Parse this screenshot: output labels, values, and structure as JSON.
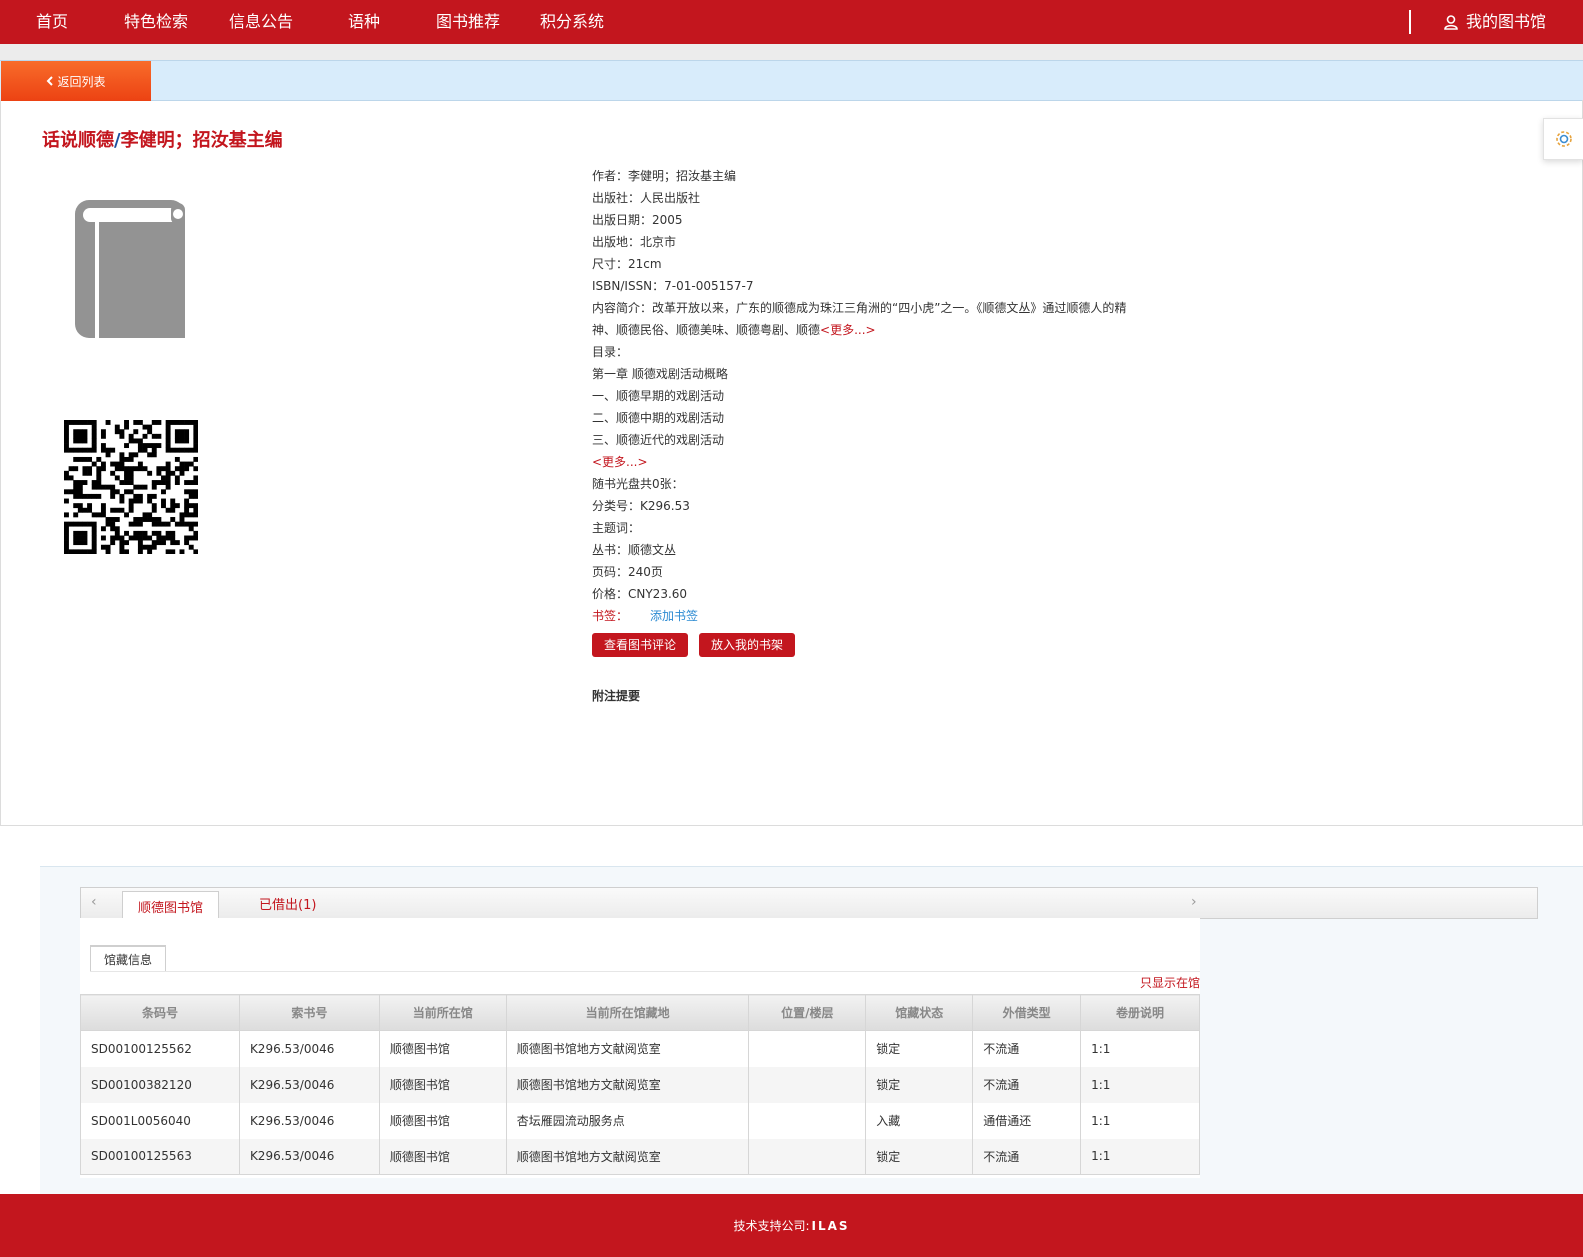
{
  "nav": {
    "items": [
      "首页",
      "特色检索",
      "信息公告",
      "语种",
      "图书推荐",
      "积分系统"
    ],
    "my_library": "我的图书馆"
  },
  "back_label": "返回列表",
  "book": {
    "title_main": "话说顺德",
    "title_slash": "/",
    "title_author": "李健明；招汝基主编"
  },
  "info": {
    "author": "作者：李健明；招汝基主编",
    "publisher": "出版社：人民出版社",
    "pub_date": "出版日期：2005",
    "pub_place": "出版地：北京市",
    "size": "尺寸：21cm",
    "isbn": "ISBN/ISSN：7-01-005157-7",
    "summary": "内容简介：改革开放以来，广东的顺德成为珠江三角洲的“四小虎”之一。《顺德文丛》通过顺德人的精神、顺德民俗、顺德美味、顺德粤剧、顺德",
    "more": "<更多...>",
    "toc_label": "目录：",
    "toc": [
      "第一章 顺德戏剧活动概略",
      "一、顺德早期的戏剧活动",
      "二、顺德中期的戏剧活动",
      "三、顺德近代的戏剧活动"
    ],
    "toc_more": "<更多...>",
    "disc": "随书光盘共0张：",
    "class_no": "分类号：K296.53",
    "subject": "主题词：",
    "series": "丛书：顺德文丛",
    "pages": "页码：240页",
    "price": "价格：CNY23.60",
    "bookmark_label": "书签：",
    "bookmark_add": "添加书签",
    "btn_reviews": "查看图书评论",
    "btn_shelf": "放入我的书架",
    "notes_title": "附注提要"
  },
  "holdings": {
    "tab_active": "顺德图书馆",
    "tab_second": "已借出(1)",
    "subtab": "馆藏信息",
    "only_in_library": "只显示在馆",
    "columns": [
      "条码号",
      "索书号",
      "当前所在馆",
      "当前所在馆藏地",
      "位置/楼层",
      "馆藏状态",
      "外借类型",
      "卷册说明"
    ],
    "rows": [
      [
        "SD00100125562",
        "K296.53/0046",
        "顺德图书馆",
        "顺德图书馆地方文献阅览室",
        "",
        "锁定",
        "不流通",
        "1:1"
      ],
      [
        "SD00100382120",
        "K296.53/0046",
        "顺德图书馆",
        "顺德图书馆地方文献阅览室",
        "",
        "锁定",
        "不流通",
        "1:1"
      ],
      [
        "SD001L0056040",
        "K296.53/0046",
        "顺德图书馆",
        "杏坛雁园流动服务点",
        "",
        "入藏",
        "通借通还",
        "1:1"
      ],
      [
        "SD00100125563",
        "K296.53/0046",
        "顺德图书馆",
        "顺德图书馆地方文献阅览室",
        "",
        "锁定",
        "不流通",
        "1:1"
      ]
    ]
  },
  "footer": {
    "label": "技术支持公司:",
    "company": "ILAS"
  },
  "colors": {
    "brand_red": "#c3161e",
    "back_orange": "#f25a1f",
    "link_blue": "#2b8ad2"
  }
}
